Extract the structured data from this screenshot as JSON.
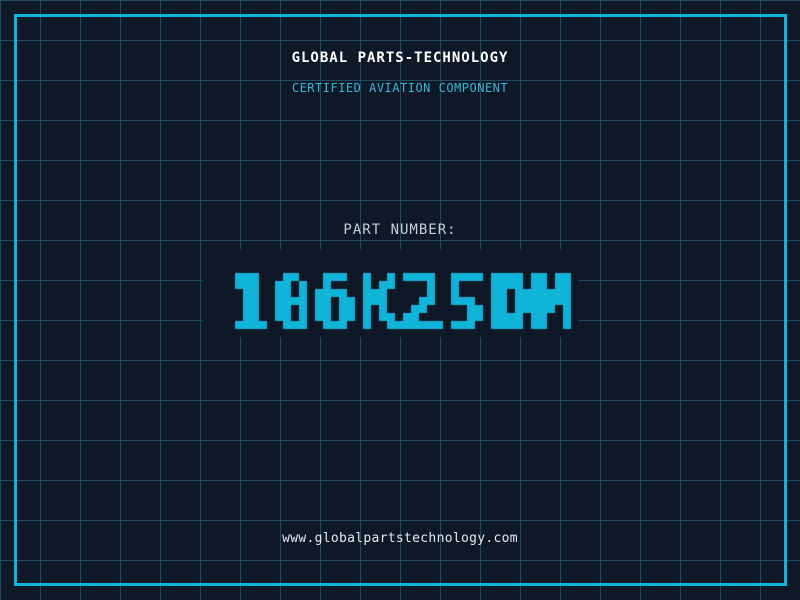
{
  "colors": {
    "bg": "#0f1826",
    "grid": "#1c4c62",
    "accent": "#12b3d8",
    "subtitle": "#35b6d9",
    "title": "#ffffff",
    "label": "#c6d0d8",
    "url": "#e4ebee"
  },
  "header": {
    "company": "GLOBAL PARTS-TECHNOLOGY",
    "subtitle": "CERTIFIED AVIATION COMPONENT"
  },
  "part": {
    "label": "PART NUMBER:",
    "number": "106K25DM"
  },
  "footer": {
    "website": "www.globalpartstechnology.com"
  }
}
